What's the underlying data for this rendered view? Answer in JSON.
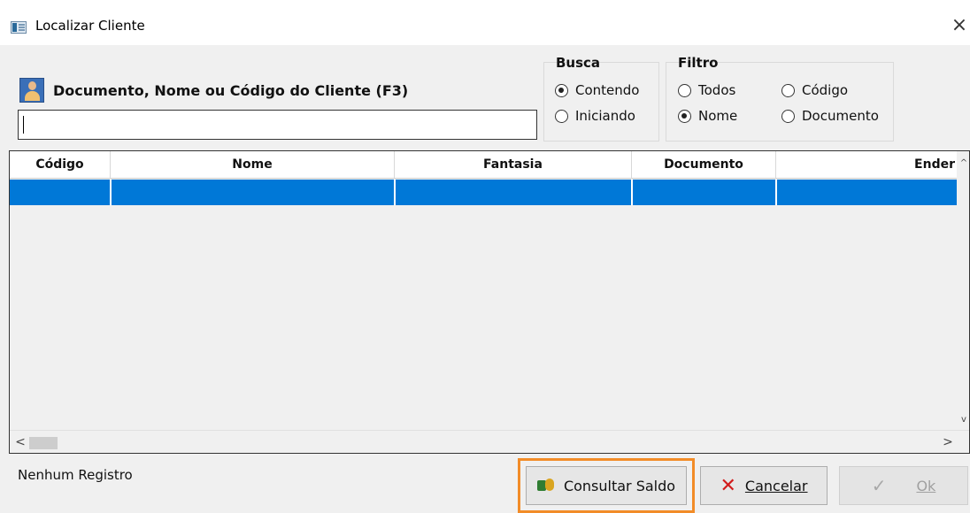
{
  "window": {
    "title": "Localizar Cliente",
    "close_glyph": "×"
  },
  "search": {
    "label": "Documento, Nome ou Código do Cliente (F3)",
    "value": "",
    "icon": "person-icon"
  },
  "busca": {
    "title": "Busca",
    "options": [
      {
        "label": "Contendo",
        "selected": true
      },
      {
        "label": "Iniciando",
        "selected": false
      }
    ]
  },
  "filtro": {
    "title": "Filtro",
    "options": [
      {
        "label": "Todos",
        "selected": false
      },
      {
        "label": "Código",
        "selected": false
      },
      {
        "label": "Nome",
        "selected": true
      },
      {
        "label": "Documento",
        "selected": false
      }
    ]
  },
  "grid": {
    "columns": [
      "Código",
      "Nome",
      "Fantasia",
      "Documento",
      "Ender"
    ],
    "selection_color": "#0078d7"
  },
  "status": {
    "text": "Nenhum Registro"
  },
  "buttons": {
    "consultar": "Consultar Saldo",
    "cancelar": "Cancelar",
    "ok": "Ok"
  },
  "colors": {
    "highlight": "#f28c28",
    "cancel_icon": "#d21b1b"
  }
}
